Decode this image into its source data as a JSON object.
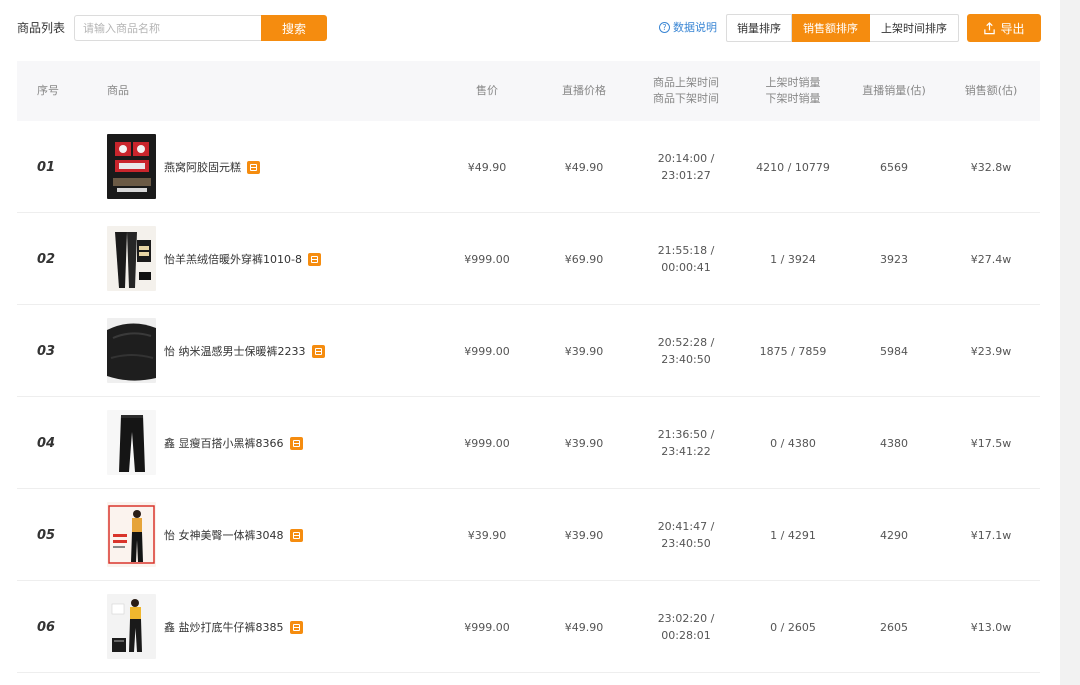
{
  "toolbar": {
    "title": "商品列表",
    "search_placeholder": "请输入商品名称",
    "search_button": "搜索",
    "help_link": "数据说明",
    "sort_buttons": [
      "销量排序",
      "销售额排序",
      "上架时间排序"
    ],
    "active_sort": "销售额排序",
    "export_button": "导出"
  },
  "table": {
    "headers": {
      "index": "序号",
      "product": "商品",
      "price": "售价",
      "live_price": "直播价格",
      "time_line1": "商品上架时间",
      "time_line2": "商品下架时间",
      "sales_line1": "上架时销量",
      "sales_line2": "下架时销量",
      "live_sales": "直播销量(估)",
      "revenue": "销售额(估)"
    },
    "rows": [
      {
        "rank": "01",
        "name": "燕窝阿胶固元糕",
        "price": "¥49.90",
        "live_price": "¥49.90",
        "on_time": "20:14:00 /",
        "off_time": "23:01:27",
        "sales": "4210 / 10779",
        "live_sales": "6569",
        "revenue": "¥32.8w"
      },
      {
        "rank": "02",
        "name": "怡羊羔绒倍暖外穿裤1010-8",
        "price": "¥999.00",
        "live_price": "¥69.90",
        "on_time": "21:55:18 /",
        "off_time": "00:00:41",
        "sales": "1 / 3924",
        "live_sales": "3923",
        "revenue": "¥27.4w"
      },
      {
        "rank": "03",
        "name": "怡 纳米温感男士保暖裤2233",
        "price": "¥999.00",
        "live_price": "¥39.90",
        "on_time": "20:52:28 /",
        "off_time": "23:40:50",
        "sales": "1875 / 7859",
        "live_sales": "5984",
        "revenue": "¥23.9w"
      },
      {
        "rank": "04",
        "name": "鑫 显瘦百搭小黑裤8366",
        "price": "¥999.00",
        "live_price": "¥39.90",
        "on_time": "21:36:50 /",
        "off_time": "23:41:22",
        "sales": "0 / 4380",
        "live_sales": "4380",
        "revenue": "¥17.5w"
      },
      {
        "rank": "05",
        "name": "怡 女神美臀一体裤3048",
        "price": "¥39.90",
        "live_price": "¥39.90",
        "on_time": "20:41:47 /",
        "off_time": "23:40:50",
        "sales": "1 / 4291",
        "live_sales": "4290",
        "revenue": "¥17.1w"
      },
      {
        "rank": "06",
        "name": "鑫 盐炒打底牛仔裤8385",
        "price": "¥999.00",
        "live_price": "¥49.90",
        "on_time": "23:02:20 /",
        "off_time": "00:28:01",
        "sales": "0 / 2605",
        "live_sales": "2605",
        "revenue": "¥13.0w"
      }
    ]
  }
}
